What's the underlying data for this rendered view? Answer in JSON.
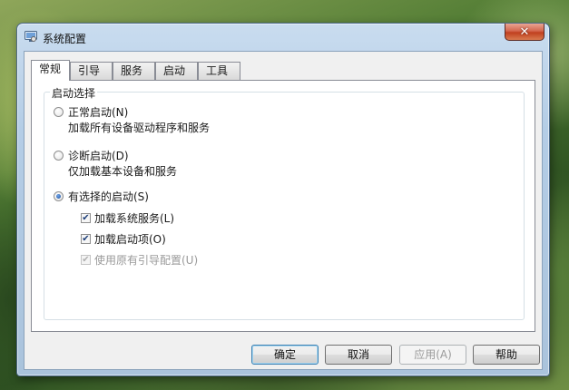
{
  "window": {
    "title": "系统配置",
    "close_glyph": "✕",
    "icon": "system-config-icon"
  },
  "tabs": [
    {
      "label": "常规",
      "active": true
    },
    {
      "label": "引导",
      "active": false
    },
    {
      "label": "服务",
      "active": false
    },
    {
      "label": "启动",
      "active": false
    },
    {
      "label": "工具",
      "active": false
    }
  ],
  "startup_group": {
    "legend": "启动选择",
    "options": [
      {
        "label": "正常启动(N)",
        "description": "加载所有设备驱动程序和服务",
        "checked": false
      },
      {
        "label": "诊断启动(D)",
        "description": "仅加载基本设备和服务",
        "checked": false
      },
      {
        "label": "有选择的启动(S)",
        "checked": true
      }
    ],
    "selective_items": [
      {
        "label": "加载系统服务(L)",
        "checked": true,
        "enabled": true
      },
      {
        "label": "加载启动项(O)",
        "checked": true,
        "enabled": true
      },
      {
        "label": "使用原有引导配置(U)",
        "checked": true,
        "enabled": false
      }
    ]
  },
  "buttons": {
    "ok": "确定",
    "cancel": "取消",
    "apply": "应用(A)",
    "help": "帮助"
  },
  "glyphs": {
    "check": "✔"
  }
}
